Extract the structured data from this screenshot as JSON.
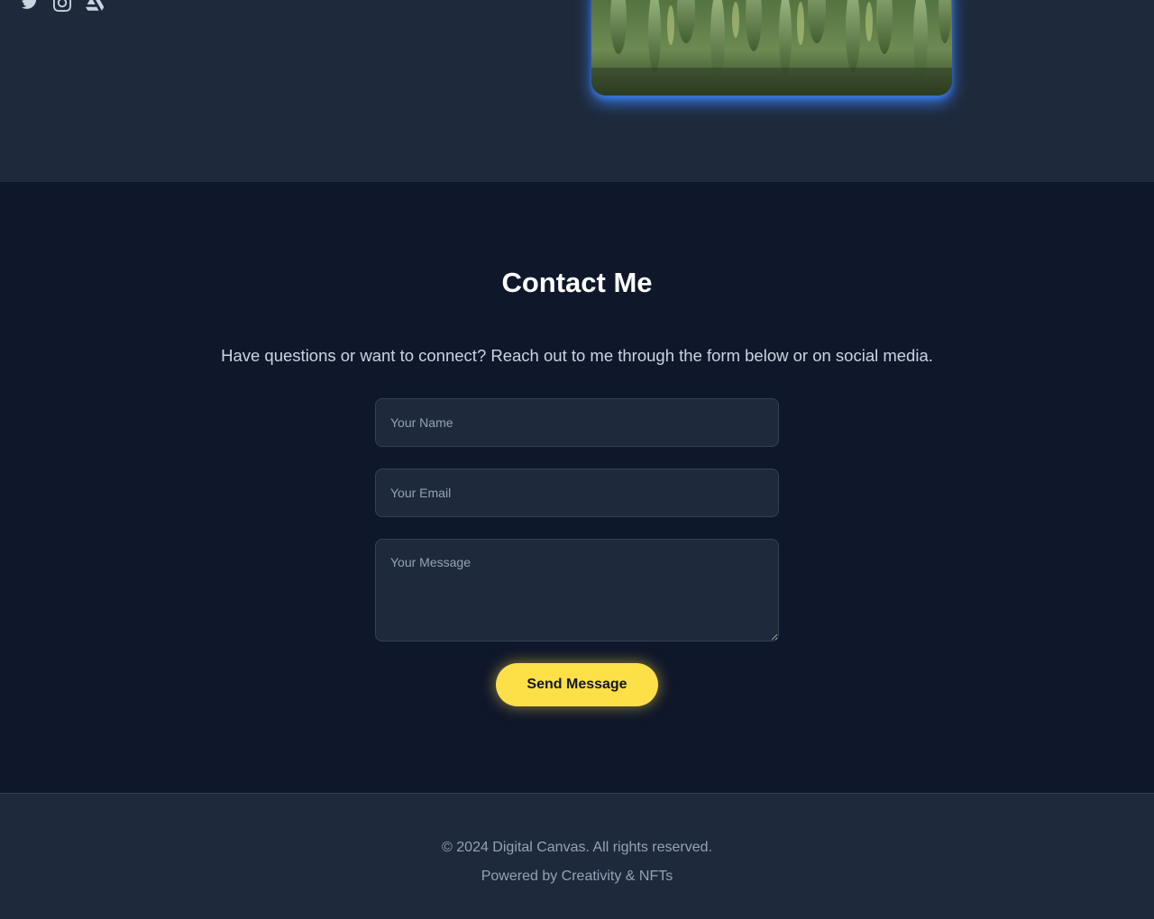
{
  "social": {
    "icons": [
      "twitter-icon",
      "instagram-icon",
      "artstation-icon"
    ]
  },
  "artwork": {
    "image": "wheat-field-image"
  },
  "contact": {
    "title": "Contact Me",
    "description": "Have questions or want to connect? Reach out to me through the form below or on social media.",
    "name_placeholder": "Your Name",
    "email_placeholder": "Your Email",
    "message_placeholder": "Your Message",
    "send_label": "Send Message"
  },
  "footer": {
    "copyright": "© 2024 Digital Canvas. All rights reserved.",
    "powered": "Powered by Creativity & NFTs"
  },
  "colors": {
    "background": "#0f172a",
    "surface": "#1e293b",
    "accent": "#fde047",
    "glow": "#3b82f6"
  }
}
